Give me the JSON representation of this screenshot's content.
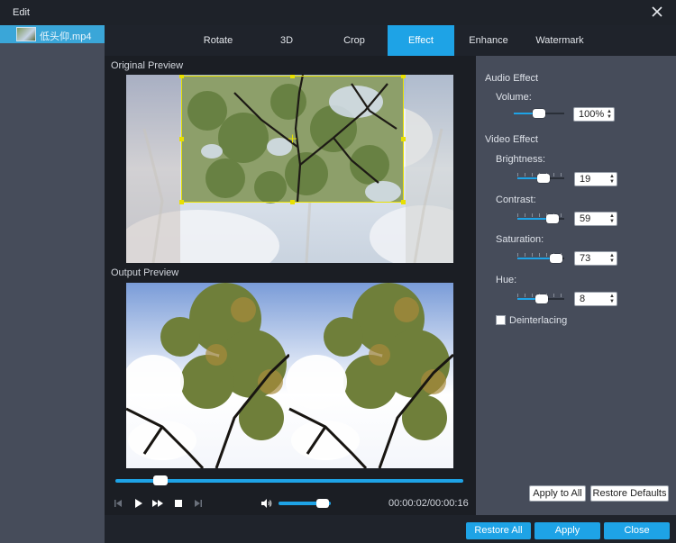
{
  "window": {
    "title": "Edit"
  },
  "sidebar": {
    "file_name": "低头仰.mp4"
  },
  "tabs": [
    {
      "label": "Rotate",
      "active": false
    },
    {
      "label": "3D",
      "active": false
    },
    {
      "label": "Crop",
      "active": false
    },
    {
      "label": "Effect",
      "active": true
    },
    {
      "label": "Enhance",
      "active": false
    },
    {
      "label": "Watermark",
      "active": false
    }
  ],
  "preview": {
    "original_label": "Original Preview",
    "output_label": "Output Preview",
    "seek_progress": 0.13,
    "volume_level": 0.85,
    "timecode": "00:00:02/00:00:16"
  },
  "audio_effect": {
    "heading": "Audio Effect",
    "volume_label": "Volume:",
    "volume_value": "100%",
    "volume_fraction": 0.5
  },
  "video_effect": {
    "heading": "Video Effect",
    "brightness_label": "Brightness:",
    "brightness_value": "19",
    "brightness_fraction": 0.55,
    "contrast_label": "Contrast:",
    "contrast_value": "59",
    "contrast_fraction": 0.75,
    "saturation_label": "Saturation:",
    "saturation_value": "73",
    "saturation_fraction": 0.82,
    "hue_label": "Hue:",
    "hue_value": "8",
    "hue_fraction": 0.52,
    "deinterlacing_label": "Deinterlacing",
    "deinterlacing_checked": false
  },
  "buttons": {
    "apply_to_all": "Apply to All",
    "restore_defaults": "Restore Defaults",
    "restore_all": "Restore All",
    "apply": "Apply",
    "close": "Close"
  },
  "colors": {
    "accent": "#1ea3e6",
    "crop_box": "#e8e000"
  },
  "icons": {
    "close": "close-icon",
    "prev": "skip-back-icon",
    "play": "play-icon",
    "ffwd": "fast-forward-icon",
    "stop": "stop-icon",
    "next": "skip-forward-icon",
    "volume": "speaker-icon"
  }
}
